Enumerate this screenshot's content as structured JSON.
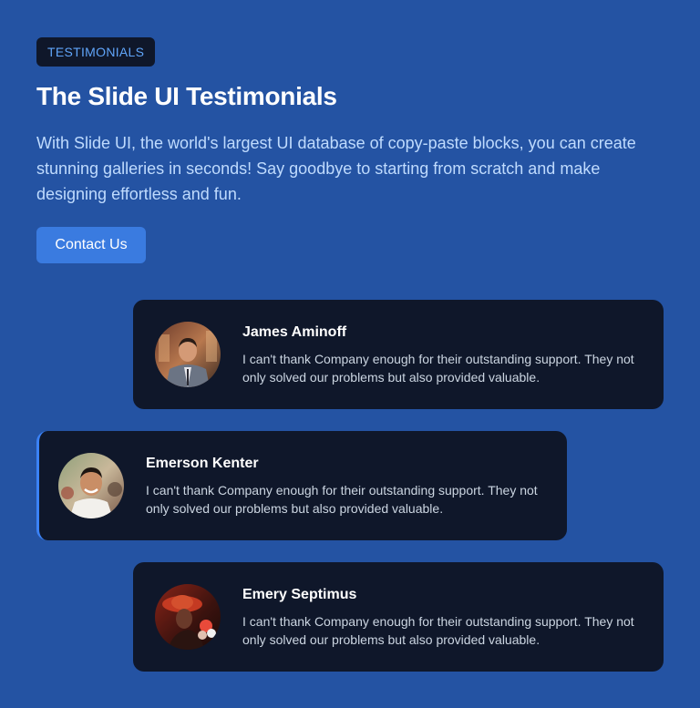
{
  "badge": "TESTIMONIALS",
  "title": "The Slide UI Testimonials",
  "description": "With Slide UI, the world's largest UI database of copy-paste blocks, you can create stunning galleries in seconds! Say goodbye to starting from scratch and make designing effortless and fun.",
  "contact_button": "Contact Us",
  "testimonials": [
    {
      "name": "James Aminoff",
      "quote": "I can't thank Company enough for their outstanding support. They not only solved our problems but also provided valuable."
    },
    {
      "name": "Emerson Kenter",
      "quote": "I can't thank Company enough for their outstanding support. They not only solved our problems but also provided valuable."
    },
    {
      "name": "Emery Septimus",
      "quote": "I can't thank Company enough for their outstanding support. They not only solved our problems but also provided valuable."
    }
  ],
  "colors": {
    "background": "#2453a3",
    "card": "#0f172a",
    "accent": "#3b82f6",
    "badge_text": "#60a5fa"
  }
}
